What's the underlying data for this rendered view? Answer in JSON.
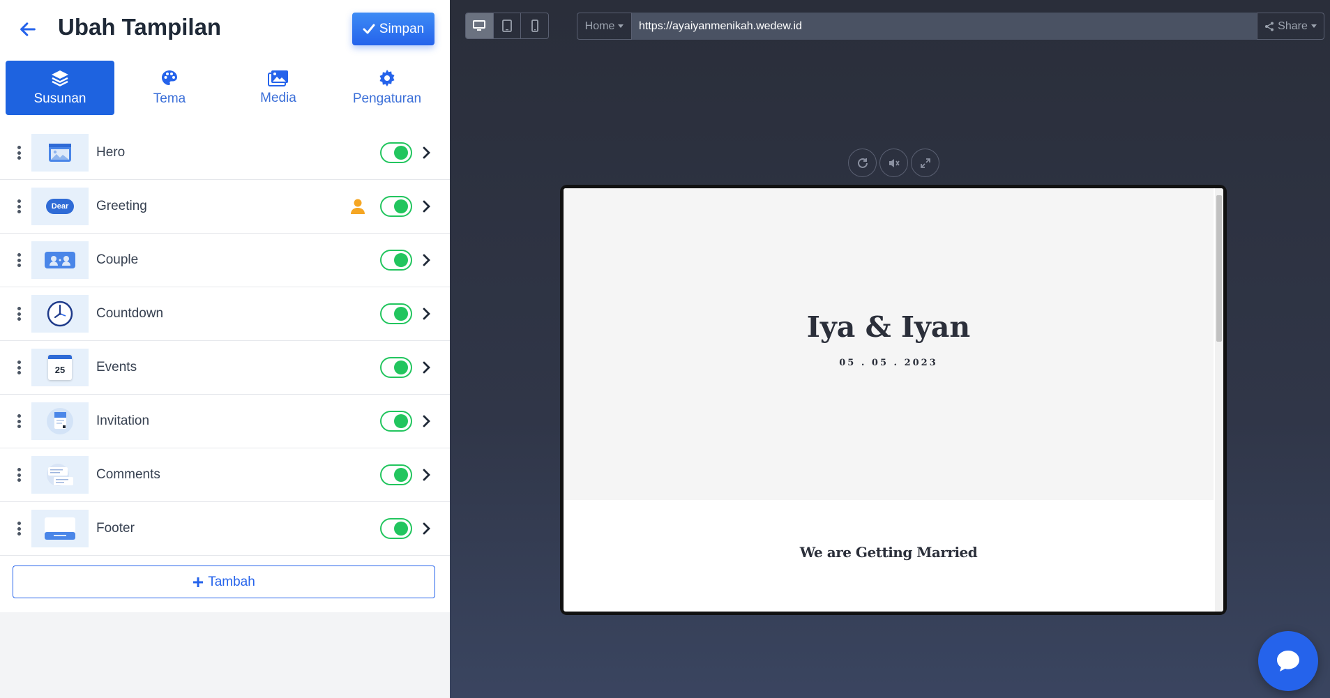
{
  "header": {
    "title": "Ubah Tampilan",
    "save_label": "Simpan"
  },
  "tabs": [
    {
      "label": "Susunan",
      "icon": "layers-icon",
      "active": true
    },
    {
      "label": "Tema",
      "icon": "palette-icon",
      "active": false
    },
    {
      "label": "Media",
      "icon": "images-icon",
      "active": false
    },
    {
      "label": "Pengaturan",
      "icon": "gear-icon",
      "active": false
    }
  ],
  "sections": [
    {
      "label": "Hero",
      "enabled": true
    },
    {
      "label": "Greeting",
      "enabled": true,
      "thumb_text": "Dear",
      "has_person_icon": true
    },
    {
      "label": "Couple",
      "enabled": true
    },
    {
      "label": "Countdown",
      "enabled": true
    },
    {
      "label": "Events",
      "enabled": true,
      "thumb_text": "25"
    },
    {
      "label": "Invitation",
      "enabled": true
    },
    {
      "label": "Comments",
      "enabled": true
    },
    {
      "label": "Footer",
      "enabled": true
    }
  ],
  "add_label": "Tambah",
  "preview": {
    "device_options": [
      "desktop-icon",
      "tablet-icon",
      "mobile-icon"
    ],
    "active_device": "desktop",
    "page_select": "Home",
    "url": "https://ayaiyanmenikah.wedew.id",
    "share_label": "Share",
    "couple_names": "Iya & Iyan",
    "date": "05 . 05 . 2023",
    "section_heading": "We are Getting Married"
  },
  "colors": {
    "accent": "#1e63e0",
    "toggle_on": "#22c55e",
    "person_badge": "#f5a623"
  }
}
